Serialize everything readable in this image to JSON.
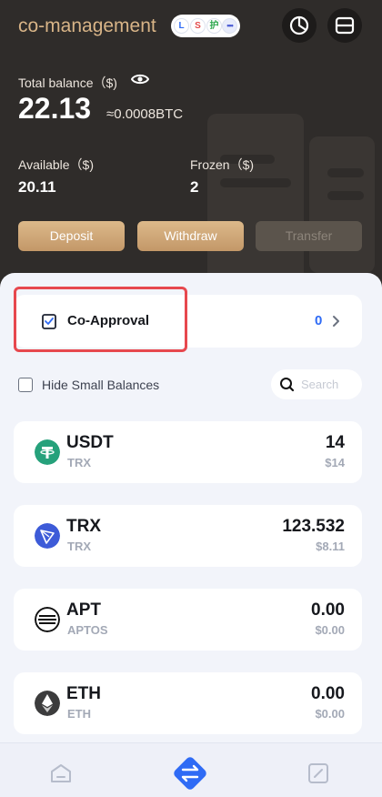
{
  "header": {
    "title": "co-management",
    "chain_chips": [
      "L",
      "S",
      "护",
      "•••"
    ],
    "history_icon": "clock-icon",
    "menu_icon": "wallet-menu-icon"
  },
  "balance": {
    "total_label": "Total balance（$)",
    "total_value": "22.13",
    "btc_value": "≈0.0008BTC",
    "available_label": "Available（$)",
    "available_value": "20.11",
    "frozen_label": "Frozen（$)",
    "frozen_value": "2"
  },
  "actions": {
    "deposit": "Deposit",
    "withdraw": "Withdraw",
    "transfer": "Transfer"
  },
  "co_approval": {
    "label": "Co-Approval",
    "count": "0"
  },
  "filters": {
    "hide_small_label": "Hide Small Balances",
    "search_placeholder": "Search"
  },
  "assets": [
    {
      "symbol": "USDT",
      "network": "TRX",
      "amount": "14",
      "usd": "$14",
      "icon": "tether-icon"
    },
    {
      "symbol": "TRX",
      "network": "TRX",
      "amount": "123.532",
      "usd": "$8.11",
      "icon": "tron-icon"
    },
    {
      "symbol": "APT",
      "network": "APTOS",
      "amount": "0.00",
      "usd": "$0.00",
      "icon": "aptos-icon"
    },
    {
      "symbol": "ETH",
      "network": "ETH",
      "amount": "0.00",
      "usd": "$0.00",
      "icon": "ethereum-icon"
    }
  ],
  "nav": {
    "items": [
      "home-icon",
      "transfer-icon",
      "edit-icon"
    ]
  },
  "colors": {
    "gold": "#d8b487",
    "header_bg": "#2f2c2a",
    "accent_blue": "#2f6bf5",
    "highlight_red": "#e7484e"
  }
}
